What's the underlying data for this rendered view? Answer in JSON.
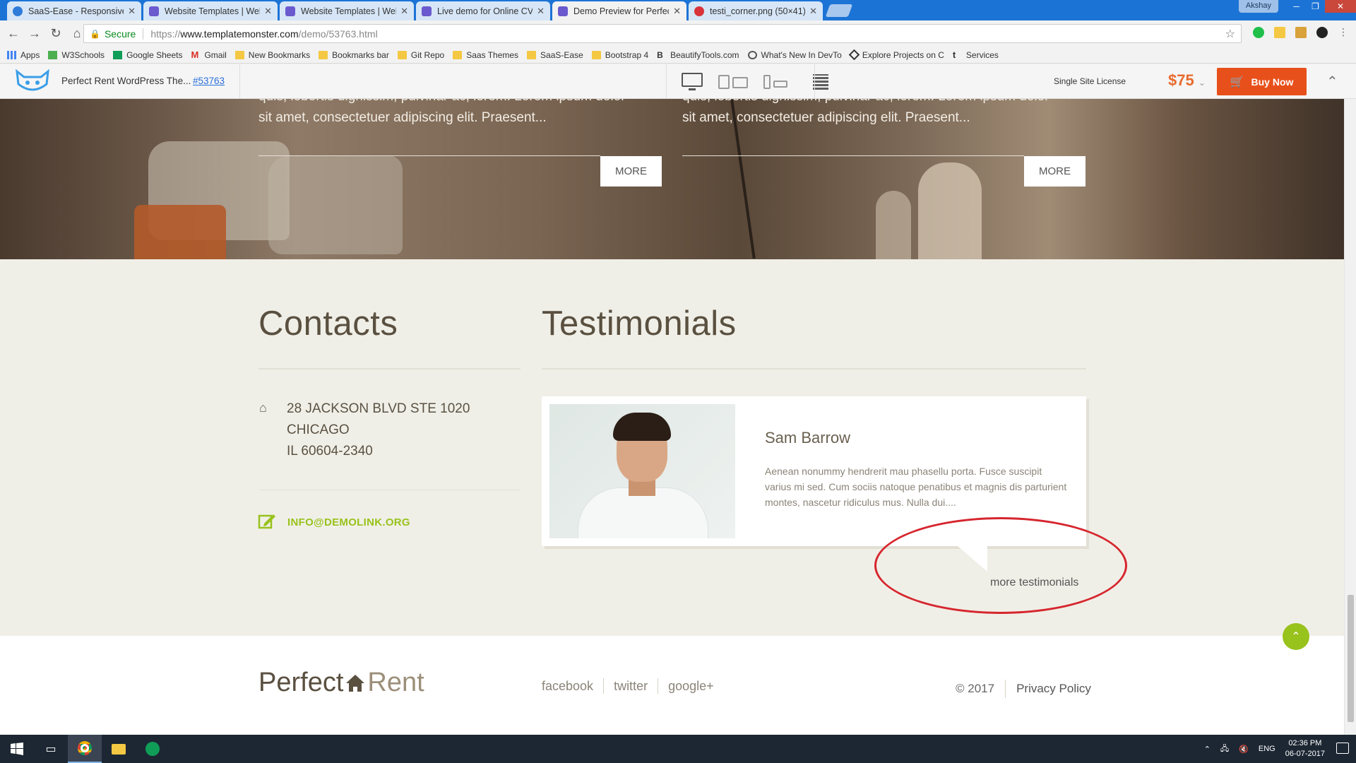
{
  "browser": {
    "tabs": [
      {
        "title": "SaaS-Ease - Responsive S",
        "active": false,
        "color": "#2f7bd9"
      },
      {
        "title": "Website Templates | Web",
        "active": false,
        "color": "#6a5acd"
      },
      {
        "title": "Website Templates | Web",
        "active": false,
        "color": "#6a5acd"
      },
      {
        "title": "Live demo for Online CV",
        "active": false,
        "color": "#6a5acd"
      },
      {
        "title": "Demo Preview for Perfec",
        "active": true,
        "color": "#6a5acd"
      },
      {
        "title": "testi_corner.png (50×41)",
        "active": false,
        "color": "#d8333a"
      }
    ],
    "user": "Akshay",
    "address": {
      "secure_label": "Secure",
      "url_scheme": "https://",
      "url_host": "www.templatemonster.com",
      "url_path": "/demo/53763.html"
    },
    "bookmarks": [
      {
        "label": "Apps",
        "icon": "apps-grid-icon"
      },
      {
        "label": "W3Schools",
        "icon": "w3schools-icon"
      },
      {
        "label": "Google Sheets",
        "icon": "sheets-icon"
      },
      {
        "label": "Gmail",
        "icon": "gmail-icon"
      },
      {
        "label": "New Bookmarks",
        "icon": "folder-icon"
      },
      {
        "label": "Bookmarks bar",
        "icon": "folder-icon"
      },
      {
        "label": "Git Repo",
        "icon": "folder-icon"
      },
      {
        "label": "Saas Themes",
        "icon": "folder-icon"
      },
      {
        "label": "SaaS-Ease",
        "icon": "folder-icon"
      },
      {
        "label": "Bootstrap 4",
        "icon": "folder-icon"
      },
      {
        "label": "BeautifyTools.com",
        "icon": "bt-icon"
      },
      {
        "label": "What's New In DevTo",
        "icon": "devtools-icon"
      },
      {
        "label": "Explore Projects on C",
        "icon": "codepen-icon"
      },
      {
        "label": "Services",
        "icon": "tumblr-icon"
      }
    ]
  },
  "preview_header": {
    "template_title": "Perfect Rent WordPress The...",
    "template_id": "#53763",
    "license": "Single Site License",
    "price": "$75",
    "buy_label": "Buy Now"
  },
  "hero": {
    "left_text_1": "quis, lobortis dignissim, pulvinar ac, lorem. Lorem ipsum dolor",
    "left_text_2": "sit amet, consectetuer adipiscing elit. Praesent...",
    "right_text_1": "quis, lobortis dignissim, pulvinar ac, lorem. Lorem ipsum dolor",
    "right_text_2": "sit amet, consectetuer adipiscing elit. Praesent...",
    "more_label": "MORE"
  },
  "contacts": {
    "title": "Contacts",
    "address_1": "28 JACKSON BLVD STE 1020",
    "address_2": "CHICAGO",
    "address_3": "IL 60604-2340",
    "email": "INFO@DEMOLINK.ORG"
  },
  "testimonials": {
    "title": "Testimonials",
    "name": "Sam Barrow",
    "body": "Aenean nonummy hendrerit mau phasellu porta. Fusce suscipit varius mi sed. Cum sociis natoque penatibus et magnis dis parturient montes, nascetur ridiculus mus. Nulla dui....",
    "more_link": "more testimonials"
  },
  "footer": {
    "brand_1": "Perfect",
    "brand_2": "Rent",
    "social": [
      "facebook",
      "twitter",
      "google+"
    ],
    "copyright": "© 2017",
    "privacy": "Privacy Policy"
  },
  "taskbar": {
    "language": "ENG",
    "time": "02:36 PM",
    "date": "06-07-2017"
  },
  "colors": {
    "accent_green": "#98c21c",
    "buy_orange": "#e8501b",
    "annotation_red": "#d6262e"
  }
}
